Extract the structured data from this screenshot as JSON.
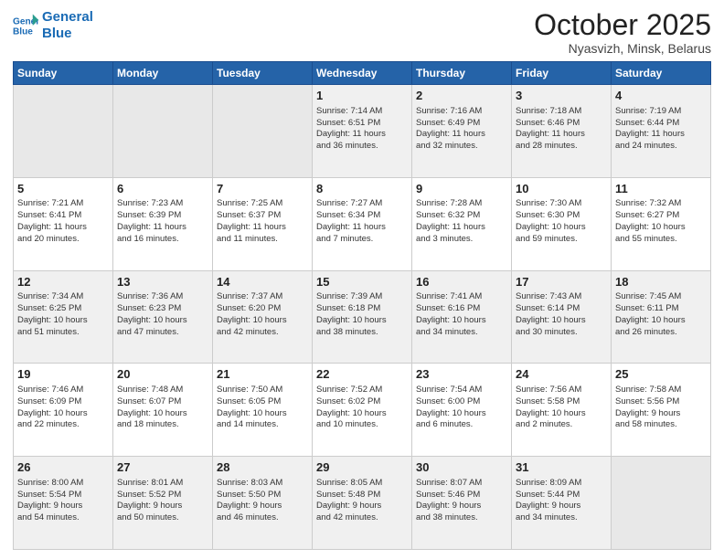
{
  "header": {
    "logo_line1": "General",
    "logo_line2": "Blue",
    "month": "October 2025",
    "location": "Nyasvizh, Minsk, Belarus"
  },
  "weekdays": [
    "Sunday",
    "Monday",
    "Tuesday",
    "Wednesday",
    "Thursday",
    "Friday",
    "Saturday"
  ],
  "weeks": [
    [
      {
        "day": "",
        "info": ""
      },
      {
        "day": "",
        "info": ""
      },
      {
        "day": "",
        "info": ""
      },
      {
        "day": "1",
        "info": "Sunrise: 7:14 AM\nSunset: 6:51 PM\nDaylight: 11 hours\nand 36 minutes."
      },
      {
        "day": "2",
        "info": "Sunrise: 7:16 AM\nSunset: 6:49 PM\nDaylight: 11 hours\nand 32 minutes."
      },
      {
        "day": "3",
        "info": "Sunrise: 7:18 AM\nSunset: 6:46 PM\nDaylight: 11 hours\nand 28 minutes."
      },
      {
        "day": "4",
        "info": "Sunrise: 7:19 AM\nSunset: 6:44 PM\nDaylight: 11 hours\nand 24 minutes."
      }
    ],
    [
      {
        "day": "5",
        "info": "Sunrise: 7:21 AM\nSunset: 6:41 PM\nDaylight: 11 hours\nand 20 minutes."
      },
      {
        "day": "6",
        "info": "Sunrise: 7:23 AM\nSunset: 6:39 PM\nDaylight: 11 hours\nand 16 minutes."
      },
      {
        "day": "7",
        "info": "Sunrise: 7:25 AM\nSunset: 6:37 PM\nDaylight: 11 hours\nand 11 minutes."
      },
      {
        "day": "8",
        "info": "Sunrise: 7:27 AM\nSunset: 6:34 PM\nDaylight: 11 hours\nand 7 minutes."
      },
      {
        "day": "9",
        "info": "Sunrise: 7:28 AM\nSunset: 6:32 PM\nDaylight: 11 hours\nand 3 minutes."
      },
      {
        "day": "10",
        "info": "Sunrise: 7:30 AM\nSunset: 6:30 PM\nDaylight: 10 hours\nand 59 minutes."
      },
      {
        "day": "11",
        "info": "Sunrise: 7:32 AM\nSunset: 6:27 PM\nDaylight: 10 hours\nand 55 minutes."
      }
    ],
    [
      {
        "day": "12",
        "info": "Sunrise: 7:34 AM\nSunset: 6:25 PM\nDaylight: 10 hours\nand 51 minutes."
      },
      {
        "day": "13",
        "info": "Sunrise: 7:36 AM\nSunset: 6:23 PM\nDaylight: 10 hours\nand 47 minutes."
      },
      {
        "day": "14",
        "info": "Sunrise: 7:37 AM\nSunset: 6:20 PM\nDaylight: 10 hours\nand 42 minutes."
      },
      {
        "day": "15",
        "info": "Sunrise: 7:39 AM\nSunset: 6:18 PM\nDaylight: 10 hours\nand 38 minutes."
      },
      {
        "day": "16",
        "info": "Sunrise: 7:41 AM\nSunset: 6:16 PM\nDaylight: 10 hours\nand 34 minutes."
      },
      {
        "day": "17",
        "info": "Sunrise: 7:43 AM\nSunset: 6:14 PM\nDaylight: 10 hours\nand 30 minutes."
      },
      {
        "day": "18",
        "info": "Sunrise: 7:45 AM\nSunset: 6:11 PM\nDaylight: 10 hours\nand 26 minutes."
      }
    ],
    [
      {
        "day": "19",
        "info": "Sunrise: 7:46 AM\nSunset: 6:09 PM\nDaylight: 10 hours\nand 22 minutes."
      },
      {
        "day": "20",
        "info": "Sunrise: 7:48 AM\nSunset: 6:07 PM\nDaylight: 10 hours\nand 18 minutes."
      },
      {
        "day": "21",
        "info": "Sunrise: 7:50 AM\nSunset: 6:05 PM\nDaylight: 10 hours\nand 14 minutes."
      },
      {
        "day": "22",
        "info": "Sunrise: 7:52 AM\nSunset: 6:02 PM\nDaylight: 10 hours\nand 10 minutes."
      },
      {
        "day": "23",
        "info": "Sunrise: 7:54 AM\nSunset: 6:00 PM\nDaylight: 10 hours\nand 6 minutes."
      },
      {
        "day": "24",
        "info": "Sunrise: 7:56 AM\nSunset: 5:58 PM\nDaylight: 10 hours\nand 2 minutes."
      },
      {
        "day": "25",
        "info": "Sunrise: 7:58 AM\nSunset: 5:56 PM\nDaylight: 9 hours\nand 58 minutes."
      }
    ],
    [
      {
        "day": "26",
        "info": "Sunrise: 8:00 AM\nSunset: 5:54 PM\nDaylight: 9 hours\nand 54 minutes."
      },
      {
        "day": "27",
        "info": "Sunrise: 8:01 AM\nSunset: 5:52 PM\nDaylight: 9 hours\nand 50 minutes."
      },
      {
        "day": "28",
        "info": "Sunrise: 8:03 AM\nSunset: 5:50 PM\nDaylight: 9 hours\nand 46 minutes."
      },
      {
        "day": "29",
        "info": "Sunrise: 8:05 AM\nSunset: 5:48 PM\nDaylight: 9 hours\nand 42 minutes."
      },
      {
        "day": "30",
        "info": "Sunrise: 8:07 AM\nSunset: 5:46 PM\nDaylight: 9 hours\nand 38 minutes."
      },
      {
        "day": "31",
        "info": "Sunrise: 8:09 AM\nSunset: 5:44 PM\nDaylight: 9 hours\nand 34 minutes."
      },
      {
        "day": "",
        "info": ""
      }
    ]
  ]
}
